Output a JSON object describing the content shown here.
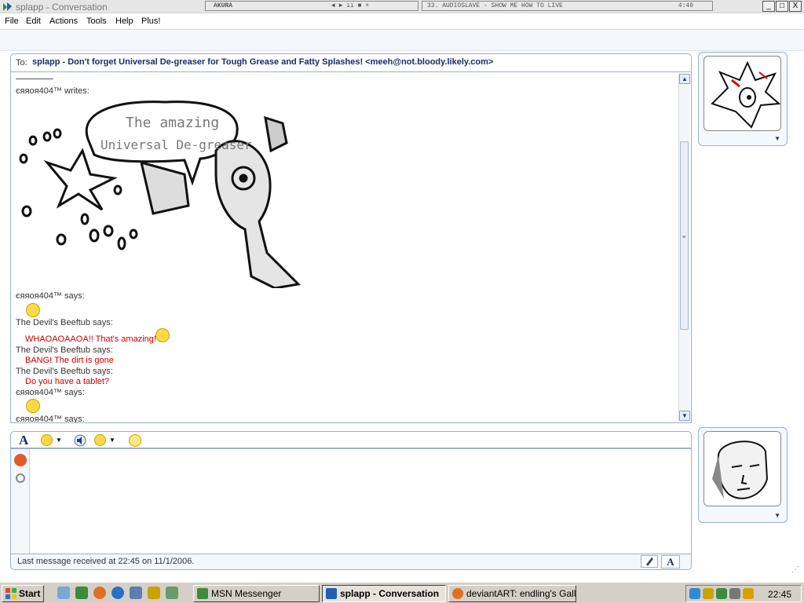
{
  "window": {
    "title": "splapp - Conversation",
    "controls": {
      "minimize": "_",
      "maximize": "□",
      "close": "X"
    }
  },
  "winamp": {
    "logo": "AKURA",
    "controls": "◄ ► ıı ■ ×",
    "track_title": "33. AUDIOSLAVE - SHOW ME HOW TO LIVE",
    "track_time": "4:40"
  },
  "menu": [
    "File",
    "Edit",
    "Actions",
    "Tools",
    "Help",
    "Plus!"
  ],
  "to": {
    "label": "To:",
    "value": "splapp - Don't forget Universal De-greaser for Tough Grease and Fatty Splashes! <meeh@not.bloody.likely.com>"
  },
  "history": {
    "first_sender": "єяяoя404™ writes:",
    "drawing_text": [
      "The amazing",
      "Universal De-greaser"
    ],
    "messages": [
      {
        "sender": "єяяoя404™ says:",
        "text": "",
        "icon": "tongue-smiley"
      },
      {
        "sender": "The Devil's Beeftub says:",
        "text": "WHAOAOAAOA!! That's amazing!",
        "icon": "smile-smiley"
      },
      {
        "sender": "The Devil's Beeftub says:",
        "text": "BANG! The dirt is gone"
      },
      {
        "sender": "The Devil's Beeftub says:",
        "text": "Do you have a tablet?"
      },
      {
        "sender": "єяяoя404™ says:",
        "text": "",
        "icon": "tongue-smiley"
      },
      {
        "sender": "єяяoя404™ says:",
        "text": ""
      }
    ]
  },
  "toolbar": {
    "font_button": "A"
  },
  "status": {
    "text": "Last message received at 22:45 on 11/1/2006.",
    "text_button": "A"
  },
  "taskbar": {
    "start_label": "Start",
    "tasks": [
      "MSN Messenger",
      "splapp - Conversation",
      "deviantART: endling's Gall..."
    ],
    "clock": "22:45"
  },
  "colors": {
    "accent": "#1b2a6b",
    "message": "#cc0000",
    "panel_border": "#9db0cc"
  }
}
